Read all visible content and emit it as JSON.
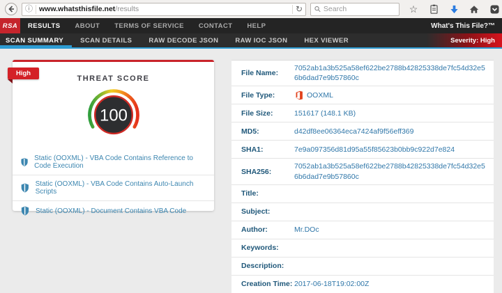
{
  "browser": {
    "url_domain": "www.whatsthisfile.net",
    "url_path": "/results",
    "search_placeholder": "Search",
    "info_glyph": "ⓘ",
    "reload_glyph": "↻",
    "star_glyph": "☆"
  },
  "navbar": {
    "logo": "RSA",
    "items": [
      "RESULTS",
      "ABOUT",
      "TERMS OF SERVICE",
      "CONTACT",
      "HELP"
    ],
    "active_item": "RESULTS",
    "brand": "What's This File?™"
  },
  "tabbar": {
    "tabs": [
      "SCAN SUMMARY",
      "SCAN DETAILS",
      "RAW DECODE JSON",
      "RAW IOC JSON",
      "HEX VIEWER"
    ],
    "active_tab": "SCAN SUMMARY",
    "severity_label": "Severity: High"
  },
  "summary": {
    "badge": "High",
    "title": "THREAT SCORE",
    "score": "100",
    "findings": [
      "Static (OOXML) - VBA Code Contains Reference to Code Execution",
      "Static (OOXML) - VBA Code Contains Auto-Launch Scripts",
      "Static (OOXML) - Document Contains VBA Code"
    ]
  },
  "details": {
    "rows": [
      {
        "label": "File Name:",
        "value": "7052ab1a3b525a58ef622be2788b42825338de7fc54d32e56b6dad7e9b57860c"
      },
      {
        "label": "File Type:",
        "value": "OOXML"
      },
      {
        "label": "File Size:",
        "value": "151617 (148.1 KB)"
      },
      {
        "label": "MD5:",
        "value": "d42df8ee06364eca7424af9f56eff369"
      },
      {
        "label": "SHA1:",
        "value": "7e9a097356d81d95a55f85623b0bb9c922d7e824"
      },
      {
        "label": "SHA256:",
        "value": "7052ab1a3b525a58ef622be2788b42825338de7fc54d32e56b6dad7e9b57860c"
      },
      {
        "label": "Title:",
        "value": ""
      },
      {
        "label": "Subject:",
        "value": ""
      },
      {
        "label": "Author:",
        "value": "Mr.DOc"
      },
      {
        "label": "Keywords:",
        "value": ""
      },
      {
        "label": "Description:",
        "value": ""
      },
      {
        "label": "Creation Time:",
        "value": "2017-06-18T19:02:00Z"
      }
    ]
  },
  "colors": {
    "accent_blue": "#2d9bd2",
    "brand_red": "#c5252c",
    "ribbon_red": "#d42127",
    "severity_red": "#d6141d",
    "label_blue": "#20587a",
    "value_blue": "#3077a9",
    "gauge_dark": "#2d2e30",
    "gauge_green": "#2f9e3c",
    "gauge_yellow": "#f0cf24",
    "gauge_red": "#e5301c",
    "office_orange": "#e2431e",
    "download_blue": "#2b7ce0"
  }
}
